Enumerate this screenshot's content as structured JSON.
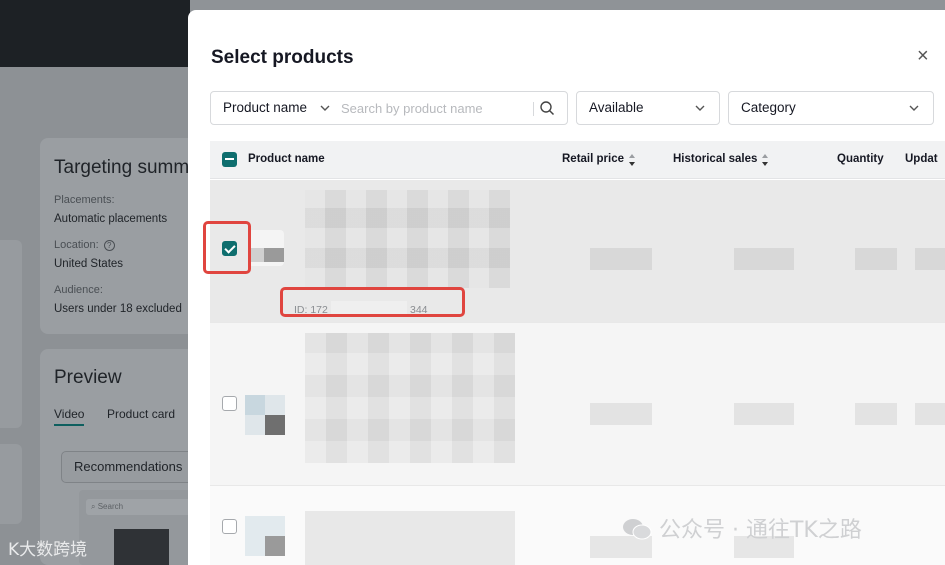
{
  "background": {
    "targeting_title": "Targeting summ",
    "placements_label": "Placements:",
    "placements_value": "Automatic placements",
    "location_label": "Location:",
    "location_value": "United States",
    "audience_label": "Audience:",
    "audience_value": "Users under 18 excluded",
    "preview_title": "Preview",
    "tabs": [
      "Video",
      "Product card"
    ],
    "recommendations_label": "Recommendations",
    "phone_search_placeholder": "Search"
  },
  "modal": {
    "title": "Select products",
    "close_glyph": "×",
    "filters": {
      "field_select": "Product name",
      "search_placeholder": "Search by product name",
      "status_select": "Available",
      "category_select": "Category"
    },
    "columns": [
      "Product name",
      "Retail price",
      "Historical sales",
      "Quantity",
      "Updat"
    ],
    "rows": [
      {
        "checked": true,
        "id_prefix": "ID: 172",
        "id_suffix": "344"
      },
      {
        "checked": false
      },
      {
        "checked": false
      }
    ]
  },
  "colors": {
    "accent": "#0e6e6e",
    "highlight": "#e0453f"
  },
  "watermarks": {
    "right": "公众号 · 通往TK之路",
    "left": "大数跨境"
  }
}
